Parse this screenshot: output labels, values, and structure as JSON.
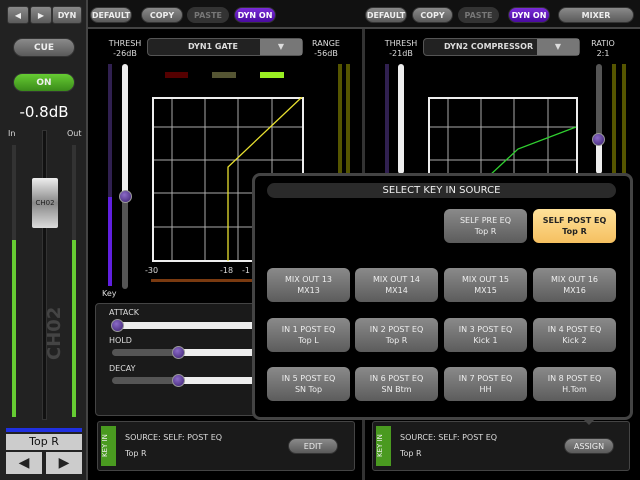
{
  "left": {
    "dyn_label": "DYN",
    "cue": "CUE",
    "on": "ON",
    "level": "-0.8dB",
    "in": "In",
    "out": "Out",
    "fader_label": "CH02",
    "channel_name_vertical": "CH02",
    "channel_name": "Top R"
  },
  "toolbar1": {
    "default": "DEFAULT",
    "copy": "COPY",
    "paste": "PASTE",
    "dyn_on": "DYN ON"
  },
  "toolbar2": {
    "default": "DEFAULT",
    "copy": "COPY",
    "paste": "PASTE",
    "dyn_on": "DYN ON",
    "mixer": "MIXER"
  },
  "dyn1": {
    "thresh_label": "THRESH",
    "thresh": "-26dB",
    "type": "DYN1 GATE",
    "range_label": "RANGE",
    "range": "-56dB",
    "key_label": "Key",
    "scale": [
      "-30",
      "-18",
      "-1"
    ],
    "params": [
      {
        "label": "ATTACK",
        "value": 0
      },
      {
        "label": "HOLD",
        "value": 0.4
      },
      {
        "label": "DECAY",
        "value": 0.4
      }
    ],
    "keyin": {
      "badge": "KEY IN",
      "source": "SOURCE:  SELF: POST EQ",
      "name": "Top R",
      "button": "EDIT"
    }
  },
  "dyn2": {
    "thresh_label": "THRESH",
    "thresh": "-21dB",
    "type": "DYN2 COMPRESSOR",
    "ratio_label": "RATIO",
    "ratio": "2:1",
    "keyin": {
      "badge": "KEY IN",
      "source": "SOURCE:  SELF: POST EQ",
      "name": "Top R",
      "button": "ASSIGN"
    }
  },
  "popup": {
    "title": "SELECT KEY IN SOURCE",
    "buttons": [
      {
        "l1": "SELF PRE EQ",
        "l2": "Top R"
      },
      {
        "l1": "SELF POST EQ",
        "l2": "Top R",
        "selected": true
      },
      {
        "l1": "MIX OUT 13",
        "l2": "MX13"
      },
      {
        "l1": "MIX OUT 14",
        "l2": "MX14"
      },
      {
        "l1": "MIX OUT 15",
        "l2": "MX15"
      },
      {
        "l1": "MIX OUT 16",
        "l2": "MX16"
      },
      {
        "l1": "IN 1 POST EQ",
        "l2": "Top L"
      },
      {
        "l1": "IN 2 POST EQ",
        "l2": "Top R"
      },
      {
        "l1": "IN 3 POST EQ",
        "l2": "Kick 1"
      },
      {
        "l1": "IN 4 POST EQ",
        "l2": "Kick 2"
      },
      {
        "l1": "IN 5 POST EQ",
        "l2": "SN Top"
      },
      {
        "l1": "IN 6 POST EQ",
        "l2": "SN Btm"
      },
      {
        "l1": "IN 7 POST EQ",
        "l2": "HH"
      },
      {
        "l1": "IN 8 POST EQ",
        "l2": "H.Tom"
      }
    ]
  },
  "colors": {
    "accent": "#5a18c0",
    "selected": "#f5c060",
    "on": "#4aa82a",
    "gate_curve": "#e8e030",
    "comp_curve": "#30d030"
  }
}
